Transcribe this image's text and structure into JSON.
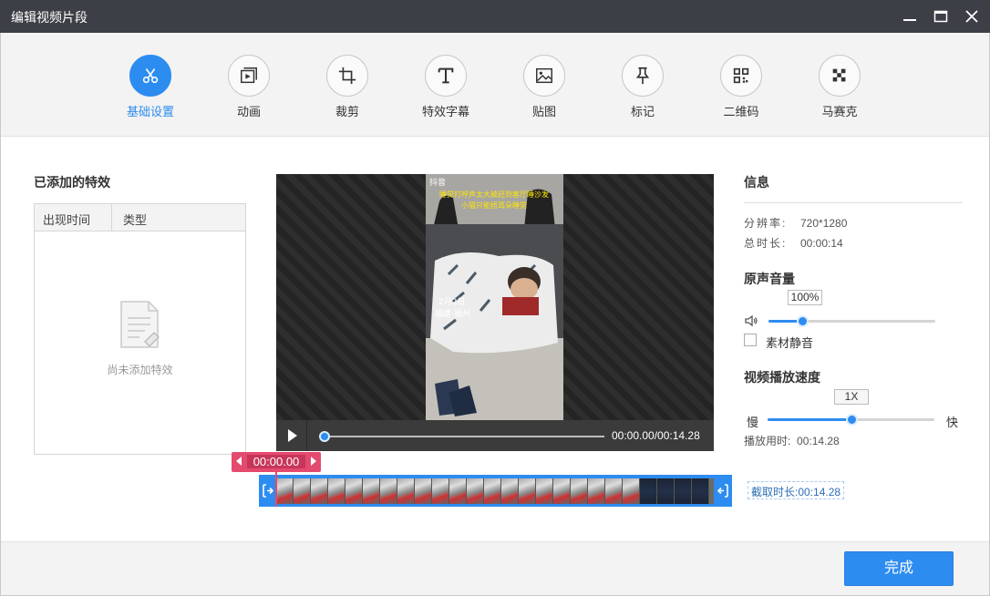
{
  "window": {
    "title": "编辑视频片段"
  },
  "toolbar": {
    "items": [
      {
        "label": "基础设置",
        "icon": "scissors-icon",
        "active": true
      },
      {
        "label": "动画",
        "icon": "animation-icon"
      },
      {
        "label": "裁剪",
        "icon": "crop-icon"
      },
      {
        "label": "特效字幕",
        "icon": "text-icon"
      },
      {
        "label": "贴图",
        "icon": "image-icon"
      },
      {
        "label": "标记",
        "icon": "pin-icon"
      },
      {
        "label": "二维码",
        "icon": "qrcode-icon"
      },
      {
        "label": "马赛克",
        "icon": "mosaic-icon"
      }
    ]
  },
  "effects": {
    "title": "已添加的特效",
    "columns": [
      "出现时间",
      "类型"
    ],
    "empty_text": "尚未添加特效"
  },
  "player": {
    "time": "00:00.00/00:14.28",
    "progress": 0.0,
    "frame_text": {
      "app": "抖音",
      "line1": "睡觉打呼声太大被赶到客厅睡沙发",
      "line2": "小猫只能捂耳朵睡觉",
      "date": "2月2日",
      "place": "福建·福州"
    }
  },
  "timeline": {
    "current": "00:00.00",
    "duration_label": "截取时长:00:14.28"
  },
  "info": {
    "title": "信息",
    "resolution_label": "分辨率:",
    "resolution": "720*1280",
    "duration_label": "总时长:",
    "duration": "00:00:14"
  },
  "volume": {
    "title": "原声音量",
    "value": "100%",
    "level": 0.2,
    "mute_label": "素材静音",
    "muted": false
  },
  "speed": {
    "title": "视频播放速度",
    "value": "1X",
    "level": 0.5,
    "slow": "慢",
    "fast": "快",
    "play_time_label": "播放用时:",
    "play_time": "00:14.28"
  },
  "footer": {
    "done": "完成"
  },
  "colors": {
    "accent": "#2d8cf0",
    "timeline_marker": "#e44a6e",
    "titlebar": "#3c3f45"
  }
}
